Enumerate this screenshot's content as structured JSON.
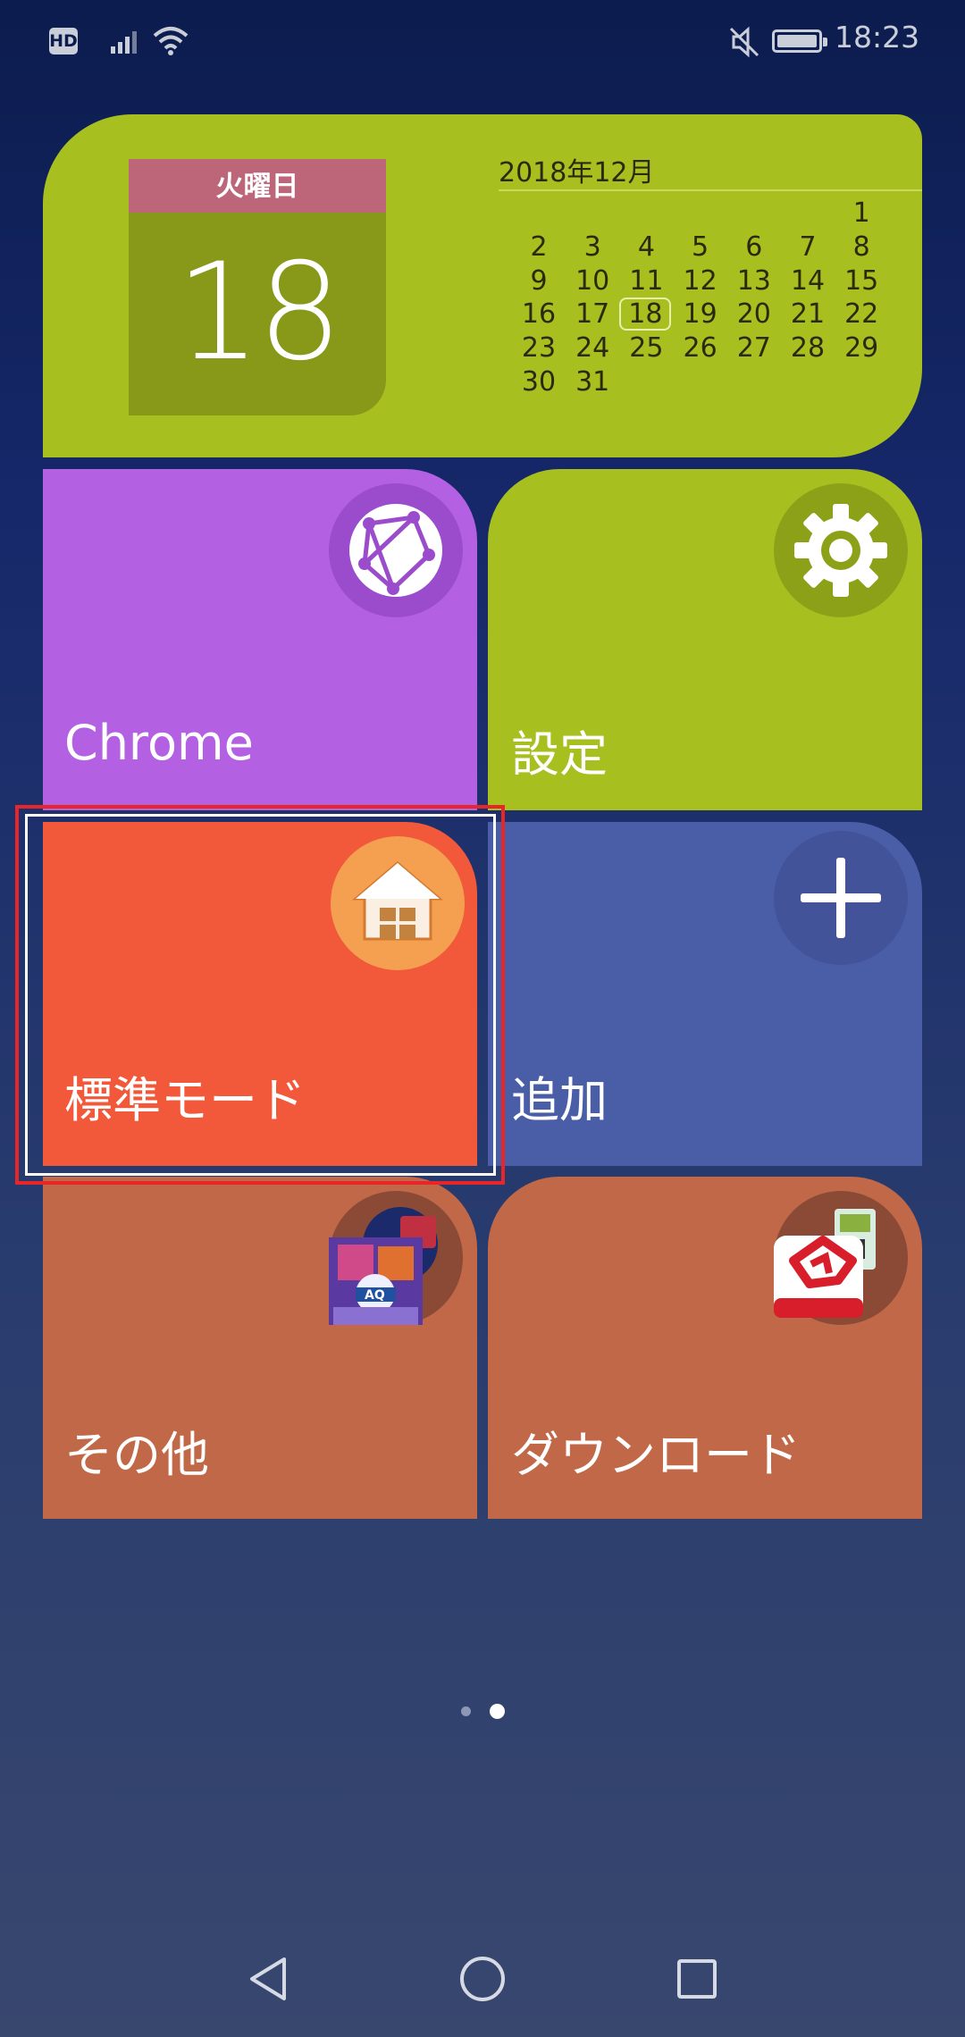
{
  "status_bar": {
    "hd_badge": "HD",
    "time": "18:23",
    "icons": [
      "hd-icon",
      "signal-icon",
      "wifi-icon",
      "mute-icon",
      "battery-icon"
    ]
  },
  "calendar": {
    "weekday": "火曜日",
    "day": "18",
    "month_title": "2018年12月",
    "rows": [
      [
        "",
        "",
        "",
        "",
        "",
        "",
        "1"
      ],
      [
        "2",
        "3",
        "4",
        "5",
        "6",
        "7",
        "8"
      ],
      [
        "9",
        "10",
        "11",
        "12",
        "13",
        "14",
        "15"
      ],
      [
        "16",
        "17",
        "18",
        "19",
        "20",
        "21",
        "22"
      ],
      [
        "23",
        "24",
        "25",
        "26",
        "27",
        "28",
        "29"
      ],
      [
        "30",
        "31",
        "",
        "",
        "",
        "",
        ""
      ]
    ],
    "today": "18"
  },
  "tiles": {
    "chrome": {
      "label": "Chrome",
      "icon": "browser-globe-icon"
    },
    "settings": {
      "label": "設定",
      "icon": "gear-icon"
    },
    "standard_mode": {
      "label": "標準モード",
      "icon": "home-icon"
    },
    "add": {
      "label": "追加",
      "icon": "plus-icon"
    },
    "other": {
      "label": "その他",
      "icon": "folder-apps-icon"
    },
    "download": {
      "label": "ダウンロード",
      "icon": "download-folder-icon"
    }
  },
  "page_indicator": {
    "count": 2,
    "active": 2
  },
  "nav_bar": {
    "icons": [
      "back-icon",
      "home-icon",
      "recent-apps-icon"
    ]
  },
  "colors": {
    "calendar_bg": "#a8bf20",
    "weekday_bar": "#bd6579",
    "chrome_tile": "#b360e3",
    "settings_tile": "#a8bf20",
    "standard_tile": "#f2593a",
    "add_tile": "#4a5ea8",
    "other_tile": "#c06848",
    "download_tile": "#c06848",
    "highlight": "#e8262a"
  }
}
